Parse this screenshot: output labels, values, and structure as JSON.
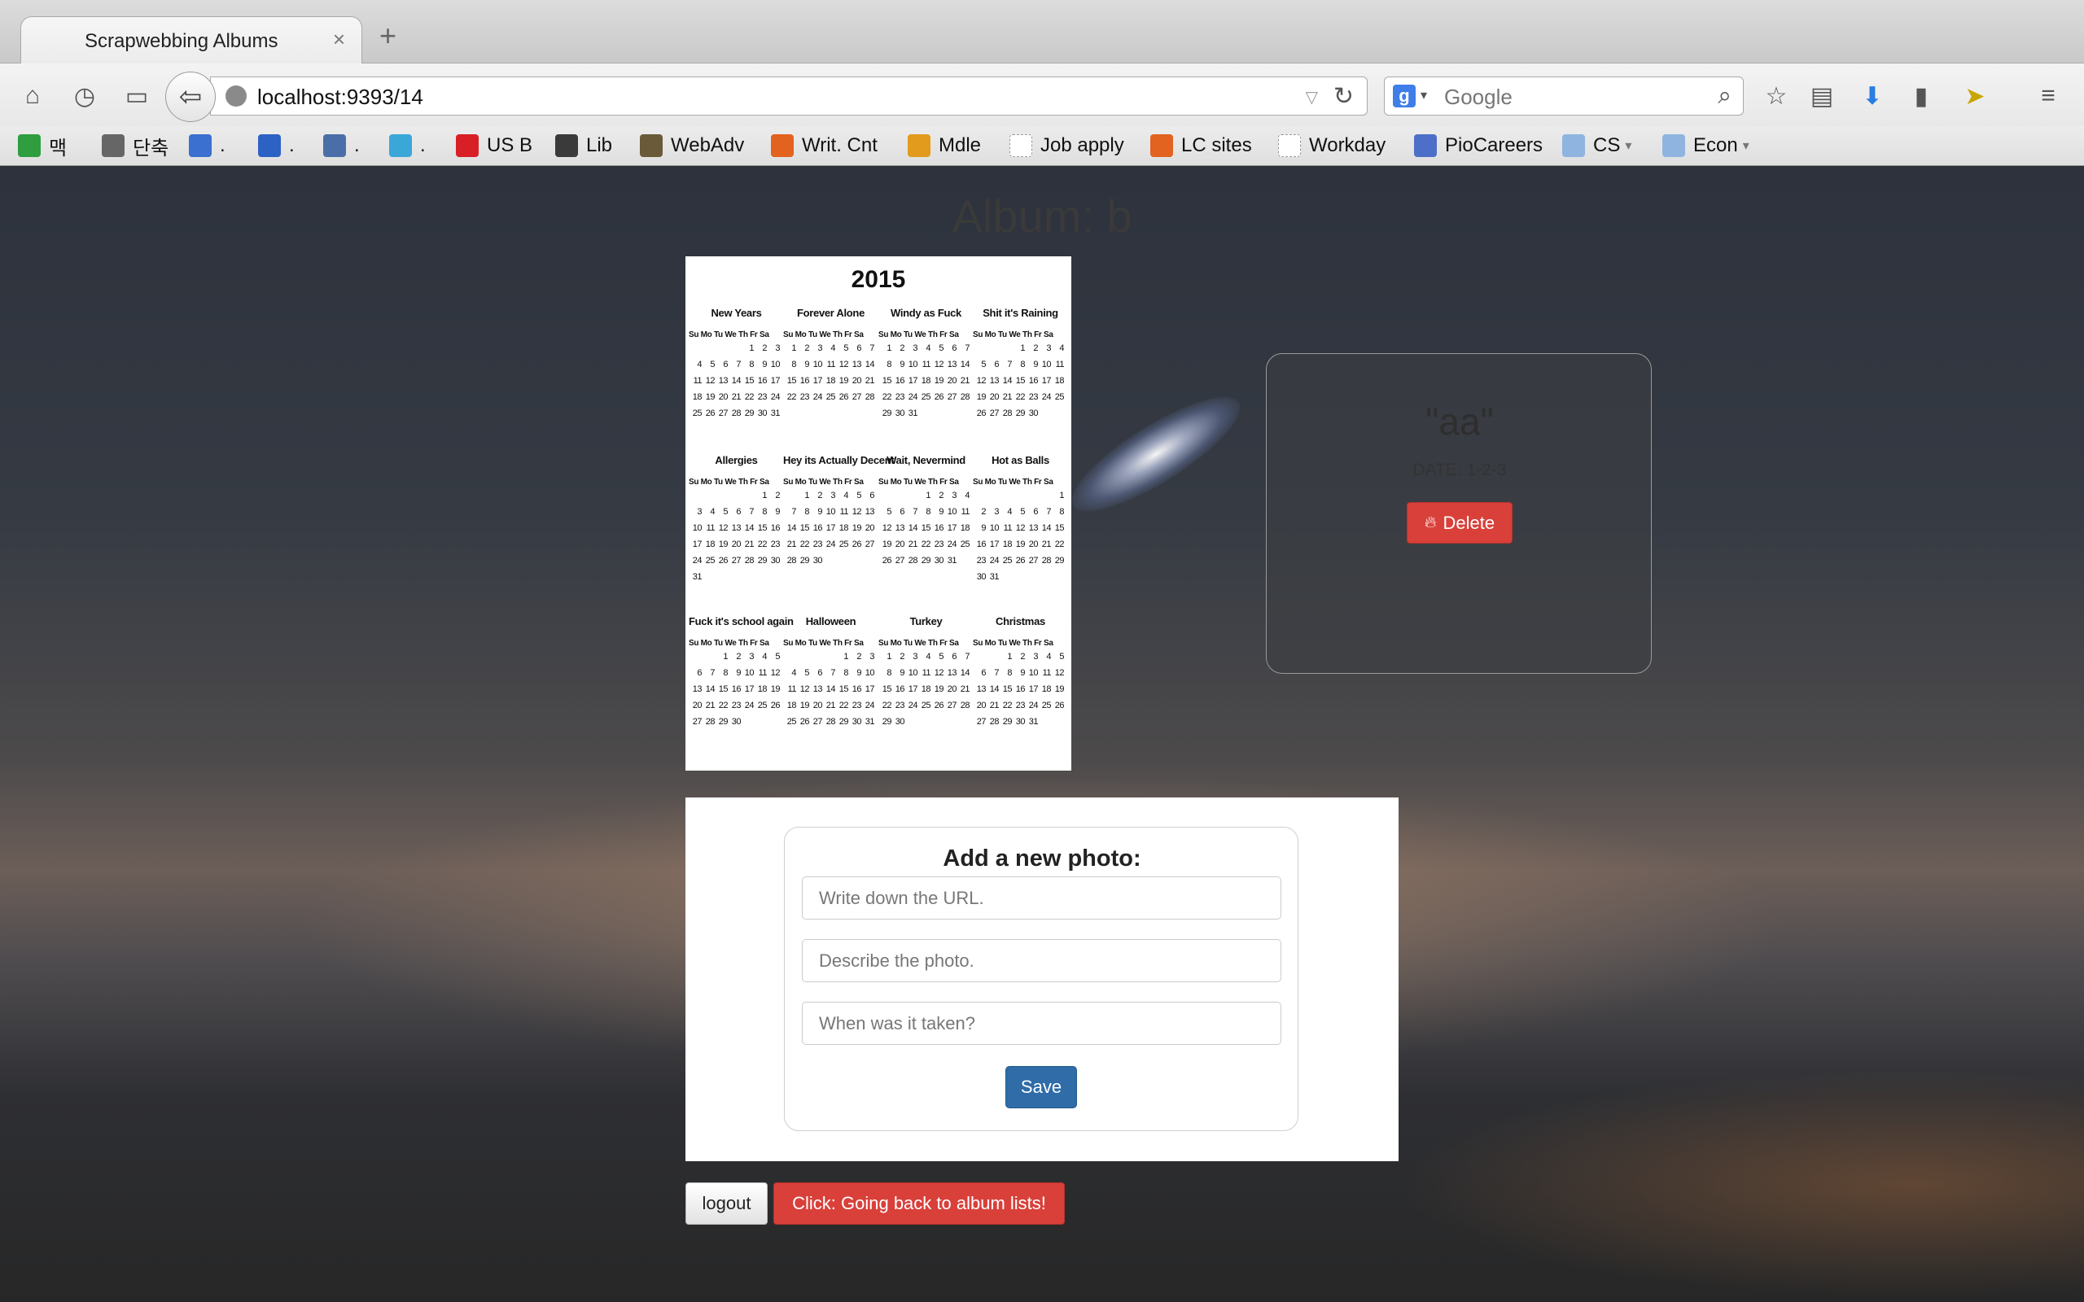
{
  "browser": {
    "tab_title": "Scrapwebbing Albums",
    "tab_close": "×",
    "new_tab": "+",
    "url": "localhost:9393/14",
    "search_engine_letter": "g",
    "search_placeholder": "Google"
  },
  "bookmarks": [
    {
      "label": "맥",
      "icon": "colorful-circle-icon",
      "color": "#2e9e3e"
    },
    {
      "label": "단축",
      "icon": "apple-icon",
      "color": "#666666"
    },
    {
      "label": ".",
      "icon": "m-icon",
      "color": "#3b6fd0"
    },
    {
      "label": ".",
      "icon": "f-icon",
      "color": "#2d62c5"
    },
    {
      "label": ".",
      "icon": "jo-icon",
      "color": "#4a6fa8"
    },
    {
      "label": ".",
      "icon": "grid-icon",
      "color": "#3aa7d8"
    },
    {
      "label": "US B",
      "icon": "us-bank-icon",
      "color": "#d91f26"
    },
    {
      "label": "Lib",
      "icon": "library-icon",
      "color": "#3a3a3a"
    },
    {
      "label": "WebAdv",
      "icon": "webadv-icon",
      "color": "#6a5a3a"
    },
    {
      "label": "Writ. Cnt",
      "icon": "bookmark-flag-icon",
      "color": "#e2621f"
    },
    {
      "label": "Mdle",
      "icon": "moodle-icon",
      "color": "#e39b1d"
    },
    {
      "label": "Job apply",
      "icon": "blank-page-icon",
      "color": "#dddddd"
    },
    {
      "label": "LC sites",
      "icon": "bookmark-flag-icon",
      "color": "#e2621f"
    },
    {
      "label": "Workday",
      "icon": "blank-page-icon",
      "color": "#dddddd"
    },
    {
      "label": "PioCareers",
      "icon": "piocareers-icon",
      "color": "#4d6fc7"
    },
    {
      "label": "CS",
      "icon": "folder-icon",
      "color": "#8fb4e0",
      "dropdown": true
    },
    {
      "label": "Econ",
      "icon": "folder-icon",
      "color": "#8fb4e0",
      "dropdown": true
    }
  ],
  "album": {
    "title": "Album: b"
  },
  "calendar": {
    "year": "2015",
    "dow": "Su Mo Tu We Th Fr Sa",
    "months": [
      {
        "title": "New Years",
        "offset": 4,
        "days": 31
      },
      {
        "title": "Forever Alone",
        "offset": 0,
        "days": 28
      },
      {
        "title": "Windy as Fuck",
        "offset": 0,
        "days": 31
      },
      {
        "title": "Shit it's Raining",
        "offset": 3,
        "days": 30
      },
      {
        "title": "Allergies",
        "offset": 5,
        "days": 31
      },
      {
        "title": "Hey its Actually Decent",
        "offset": 1,
        "days": 30
      },
      {
        "title": "Wait, Nevermind",
        "offset": 3,
        "days": 31
      },
      {
        "title": "Hot as Balls",
        "offset": 6,
        "days": 31
      },
      {
        "title": "Fuck it's school again",
        "offset": 2,
        "days": 30
      },
      {
        "title": "Halloween",
        "offset": 4,
        "days": 31
      },
      {
        "title": "Turkey",
        "offset": 0,
        "days": 30
      },
      {
        "title": "Christmas",
        "offset": 2,
        "days": 31
      }
    ]
  },
  "photo_detail": {
    "description": "\"aa\"",
    "date": "DATE: 1-2-3",
    "delete_label": "Delete"
  },
  "form": {
    "title": "Add a new photo:",
    "url_placeholder": "Write down the URL.",
    "description_placeholder": "Describe the photo.",
    "date_placeholder": "When was it taken?",
    "save_label": "Save"
  },
  "footer": {
    "logout_label": "logout",
    "back_label": "Click: Going back to album lists!"
  }
}
